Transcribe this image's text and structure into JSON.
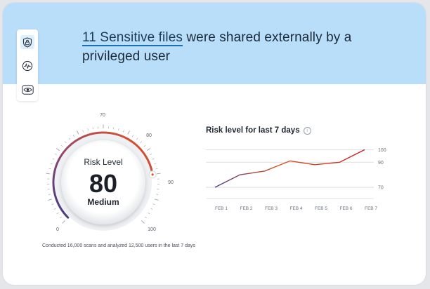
{
  "headline": {
    "highlight": "11 Sensitive files",
    "rest": " were shared externally by a privileged user"
  },
  "sidebar": {
    "items": [
      {
        "icon": "shield-lock-icon",
        "active": true
      },
      {
        "icon": "activity-icon",
        "active": false
      },
      {
        "icon": "eye-icon",
        "active": false
      }
    ]
  },
  "gauge": {
    "title": "Risk Level",
    "value": 80,
    "value_label": "80",
    "level": "Medium",
    "min": 0,
    "max": 100,
    "ticks": [
      "0",
      "70",
      "80",
      "90",
      "100"
    ]
  },
  "footnote": "Conducted 16,000 scans and analyzed 12,500 users in the last 7 days",
  "chart": {
    "title": "Risk level for last 7 days",
    "info_glyph": "i"
  },
  "chart_data": {
    "type": "line",
    "title": "Risk level for last 7 days",
    "categories": [
      "FEB 1",
      "FEB 2",
      "FEB 3",
      "FEB 4",
      "FEB 5",
      "FEB 6",
      "FEB 7"
    ],
    "values": [
      70,
      80,
      83,
      91,
      88,
      90,
      100
    ],
    "ylim": [
      65,
      103
    ],
    "yticks": [
      "70",
      "90",
      "100"
    ],
    "grid": true,
    "colors": [
      "#4a3f82",
      "#e0521a",
      "#c8212c"
    ]
  }
}
